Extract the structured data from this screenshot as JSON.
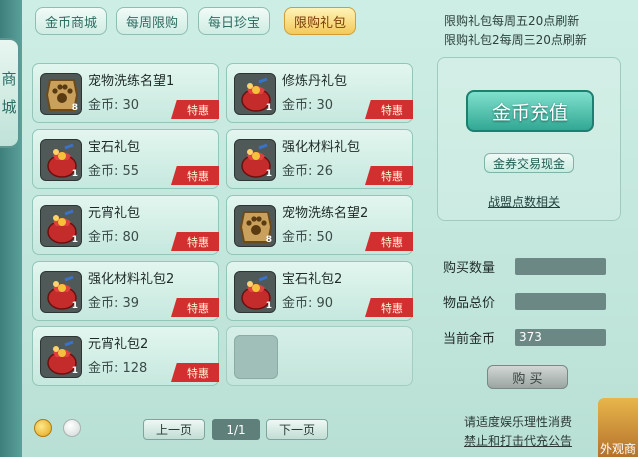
{
  "left_tab": {
    "chars": [
      "商",
      "城"
    ]
  },
  "tabs": [
    {
      "label": "金币商城"
    },
    {
      "label": "每周限购"
    },
    {
      "label": "每日珍宝"
    },
    {
      "label": "限购礼包"
    }
  ],
  "notices": [
    "限购礼包每周五20点刷新",
    "限购礼包2每周三20点刷新"
  ],
  "items": [
    {
      "name": "宠物洗练名望1",
      "price": "金币: 30",
      "count": "8",
      "badge": "特惠",
      "icon": "paw-badge-icon"
    },
    {
      "name": "修炼丹礼包",
      "price": "金币: 30",
      "count": "1",
      "badge": "特惠",
      "icon": "gift-bag-icon"
    },
    {
      "name": "宝石礼包",
      "price": "金币: 55",
      "count": "1",
      "badge": "特惠",
      "icon": "gift-bag-icon"
    },
    {
      "name": "强化材料礼包",
      "price": "金币: 26",
      "count": "1",
      "badge": "特惠",
      "icon": "gift-bag-icon"
    },
    {
      "name": "元宵礼包",
      "price": "金币: 80",
      "count": "1",
      "badge": "特惠",
      "icon": "gift-bag-icon"
    },
    {
      "name": "宠物洗练名望2",
      "price": "金币: 50",
      "count": "8",
      "badge": "特惠",
      "icon": "paw-badge-icon"
    },
    {
      "name": "强化材料礼包2",
      "price": "金币: 39",
      "count": "1",
      "badge": "特惠",
      "icon": "gift-bag-icon"
    },
    {
      "name": "宝石礼包2",
      "price": "金币: 90",
      "count": "1",
      "badge": "特惠",
      "icon": "gift-bag-icon"
    },
    {
      "name": "元宵礼包2",
      "price": "金币: 128",
      "count": "1",
      "badge": "特惠",
      "icon": "gift-bag-icon"
    }
  ],
  "right": {
    "recharge": "金币充值",
    "exchange": "金券交易现金",
    "alliance": "战盟点数相关",
    "fields": [
      {
        "label": "购买数量",
        "value": ""
      },
      {
        "label": "物品总价",
        "value": ""
      },
      {
        "label": "当前金币",
        "value": "373"
      }
    ],
    "buy": "购 买"
  },
  "pagination": {
    "prev": "上一页",
    "page": "1/1",
    "next": "下一页"
  },
  "footer": {
    "line1": "请适度娱乐理性消费",
    "line2": "禁止和打击代充公告"
  },
  "corner_text": "外观商",
  "colors": {
    "badge_red": "#d23030",
    "accent_teal": "#32a894",
    "active_tab": "#f3c95a"
  }
}
